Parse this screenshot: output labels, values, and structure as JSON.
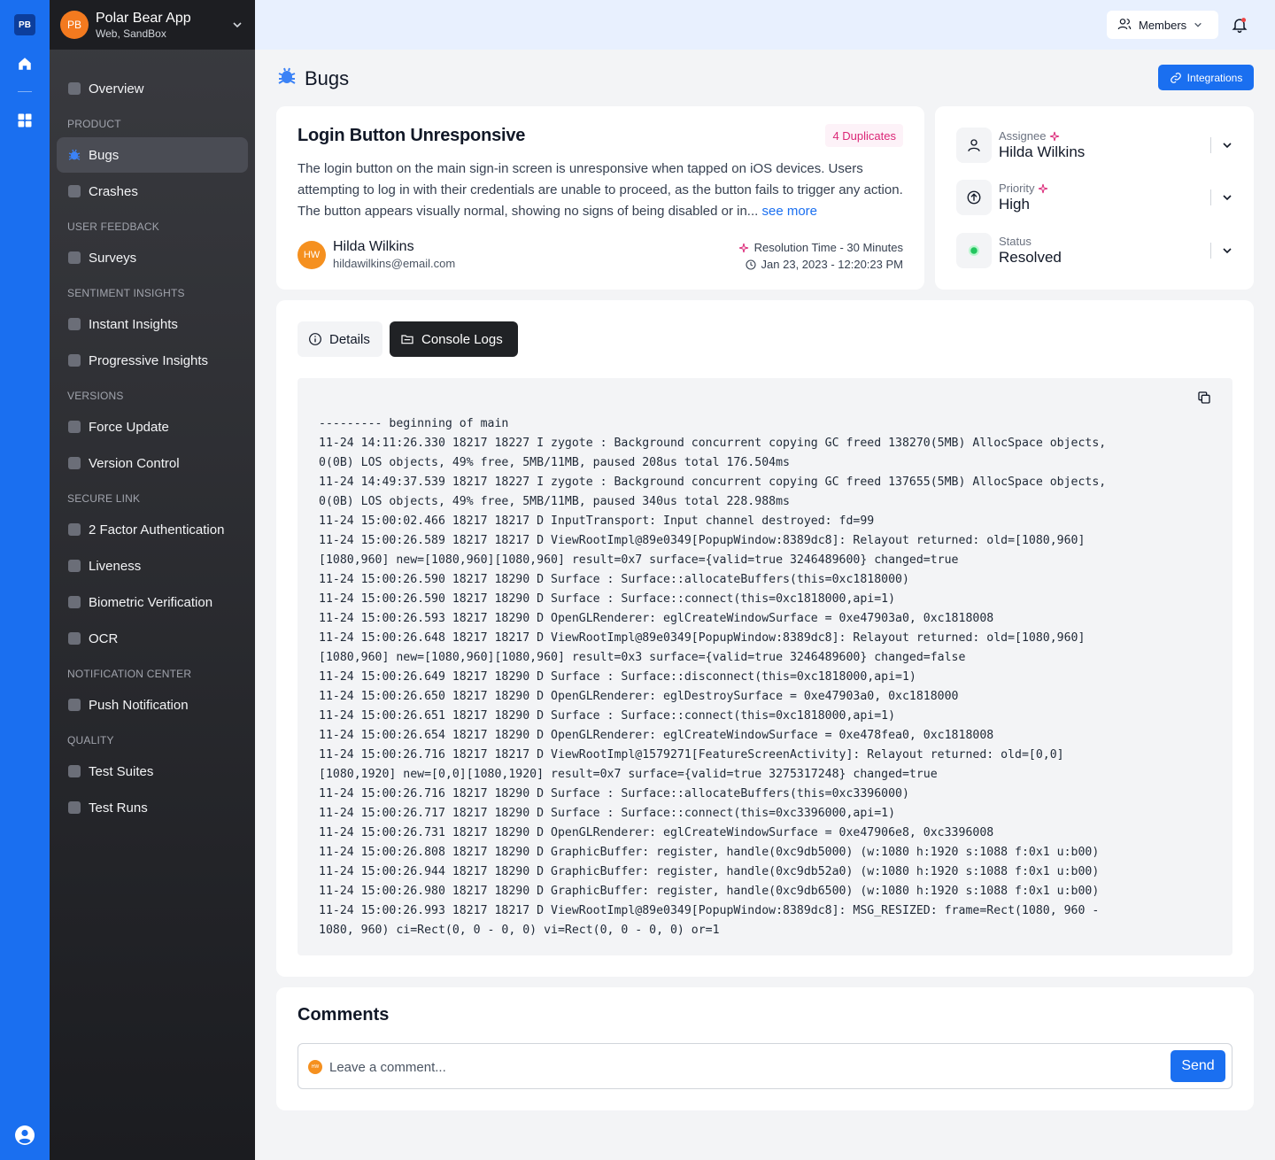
{
  "rail": {
    "logo": "PB",
    "icons": [
      "home-icon",
      "apps-grid-icon",
      "user-profile-icon"
    ]
  },
  "app": {
    "avatar": "PB",
    "name": "Polar Bear App",
    "env": "Web, SandBox"
  },
  "nav": {
    "overview": "Overview",
    "product": "PRODUCT",
    "bugs": "Bugs",
    "crashes": "Crashes",
    "user_feedback": "USER FEEDBACK",
    "surveys": "Surveys",
    "sentiment_insights": "SENTIMENT INSIGHTS",
    "instant_insights": "Instant Insights",
    "progressive_insights": "Progressive Insights",
    "versions": "VERSIONS",
    "force_update": "Force Update",
    "version_control": "Version Control",
    "secure_link": "SECURE LINK",
    "two_factor": "2 Factor Authentication",
    "liveness": "Liveness",
    "biometric": "Biometric Verification",
    "ocr": "OCR",
    "notification_center": "NOTIFICATION CENTER",
    "push_notification": "Push Notification",
    "quality": "QUALITY",
    "test_suites": "Test Suites",
    "test_runs": "Test Runs"
  },
  "topbar": {
    "members_label": "Members"
  },
  "page": {
    "title": "Bugs",
    "integrations_label": "Integrations"
  },
  "bug": {
    "title": "Login Button Unresponsive",
    "duplicates": "4 Duplicates",
    "description": "The login button on the main sign-in screen is unresponsive when tapped on iOS devices. Users attempting to log in with their credentials are unable to proceed, as the button fails to trigger any action. The button appears visually normal, showing no signs of being disabled or in...",
    "see_more": "see more",
    "reporter_initials": "HW",
    "reporter_name": "Hilda Wilkins",
    "reporter_email": "hildawilkins@email.com",
    "resolution_time": "Resolution Time - 30 Minutes",
    "timestamp": "Jan 23, 2023 - 12:20:23 PM"
  },
  "attributes": {
    "assignee_label": "Assignee",
    "assignee_value": "Hilda Wilkins",
    "priority_label": "Priority",
    "priority_value": "High",
    "status_label": "Status",
    "status_value": "Resolved",
    "status_color": "#22c55e"
  },
  "tabs": {
    "details": "Details",
    "console_logs": "Console Logs"
  },
  "console_logs": [
    "--------- beginning of main",
    "11-24 14:11:26.330 18217 18227 I zygote : Background concurrent copying GC freed 138270(5MB) AllocSpace objects,",
    "0(0B) LOS objects, 49% free, 5MB/11MB, paused 208us total 176.504ms",
    "11-24 14:49:37.539 18217 18227 I zygote : Background concurrent copying GC freed 137655(5MB) AllocSpace objects,",
    "0(0B) LOS objects, 49% free, 5MB/11MB, paused 340us total 228.988ms",
    "11-24 15:00:02.466 18217 18217 D InputTransport: Input channel destroyed: fd=99",
    "11-24 15:00:26.589 18217 18217 D ViewRootImpl@89e0349[PopupWindow:8389dc8]: Relayout returned: old=[1080,960]",
    "[1080,960] new=[1080,960][1080,960] result=0x7 surface={valid=true 3246489600} changed=true",
    "11-24 15:00:26.590 18217 18290 D Surface : Surface::allocateBuffers(this=0xc1818000)",
    "11-24 15:00:26.590 18217 18290 D Surface : Surface::connect(this=0xc1818000,api=1)",
    "11-24 15:00:26.593 18217 18290 D OpenGLRenderer: eglCreateWindowSurface = 0xe47903a0, 0xc1818008",
    "11-24 15:00:26.648 18217 18217 D ViewRootImpl@89e0349[PopupWindow:8389dc8]: Relayout returned: old=[1080,960]",
    "[1080,960] new=[1080,960][1080,960] result=0x3 surface={valid=true 3246489600} changed=false",
    "11-24 15:00:26.649 18217 18290 D Surface : Surface::disconnect(this=0xc1818000,api=1)",
    "11-24 15:00:26.650 18217 18290 D OpenGLRenderer: eglDestroySurface = 0xe47903a0, 0xc1818000",
    "11-24 15:00:26.651 18217 18290 D Surface : Surface::connect(this=0xc1818000,api=1)",
    "11-24 15:00:26.654 18217 18290 D OpenGLRenderer: eglCreateWindowSurface = 0xe478fea0, 0xc1818008",
    "11-24 15:00:26.716 18217 18217 D ViewRootImpl@1579271[FeatureScreenActivity]: Relayout returned: old=[0,0]",
    "[1080,1920] new=[0,0][1080,1920] result=0x7 surface={valid=true 3275317248} changed=true",
    "11-24 15:00:26.716 18217 18290 D Surface : Surface::allocateBuffers(this=0xc3396000)",
    "11-24 15:00:26.717 18217 18290 D Surface : Surface::connect(this=0xc3396000,api=1)",
    "11-24 15:00:26.731 18217 18290 D OpenGLRenderer: eglCreateWindowSurface = 0xe47906e8, 0xc3396008",
    "11-24 15:00:26.808 18217 18290 D GraphicBuffer: register, handle(0xc9db5000) (w:1080 h:1920 s:1088 f:0x1 u:b00)",
    "11-24 15:00:26.944 18217 18290 D GraphicBuffer: register, handle(0xc9db52a0) (w:1080 h:1920 s:1088 f:0x1 u:b00)",
    "11-24 15:00:26.980 18217 18290 D GraphicBuffer: register, handle(0xc9db6500) (w:1080 h:1920 s:1088 f:0x1 u:b00)",
    "11-24 15:00:26.993 18217 18217 D ViewRootImpl@89e0349[PopupWindow:8389dc8]: MSG_RESIZED: frame=Rect(1080, 960 -",
    "1080, 960) ci=Rect(0, 0 - 0, 0) vi=Rect(0, 0 - 0, 0) or=1"
  ],
  "comments": {
    "title": "Comments",
    "avatar": "HW",
    "placeholder": "Leave a comment...",
    "send_label": "Send"
  },
  "colors": {
    "brand": "#1a6ff0",
    "accent_pink": "#db2777",
    "avatar_orange": "#f5901f"
  }
}
